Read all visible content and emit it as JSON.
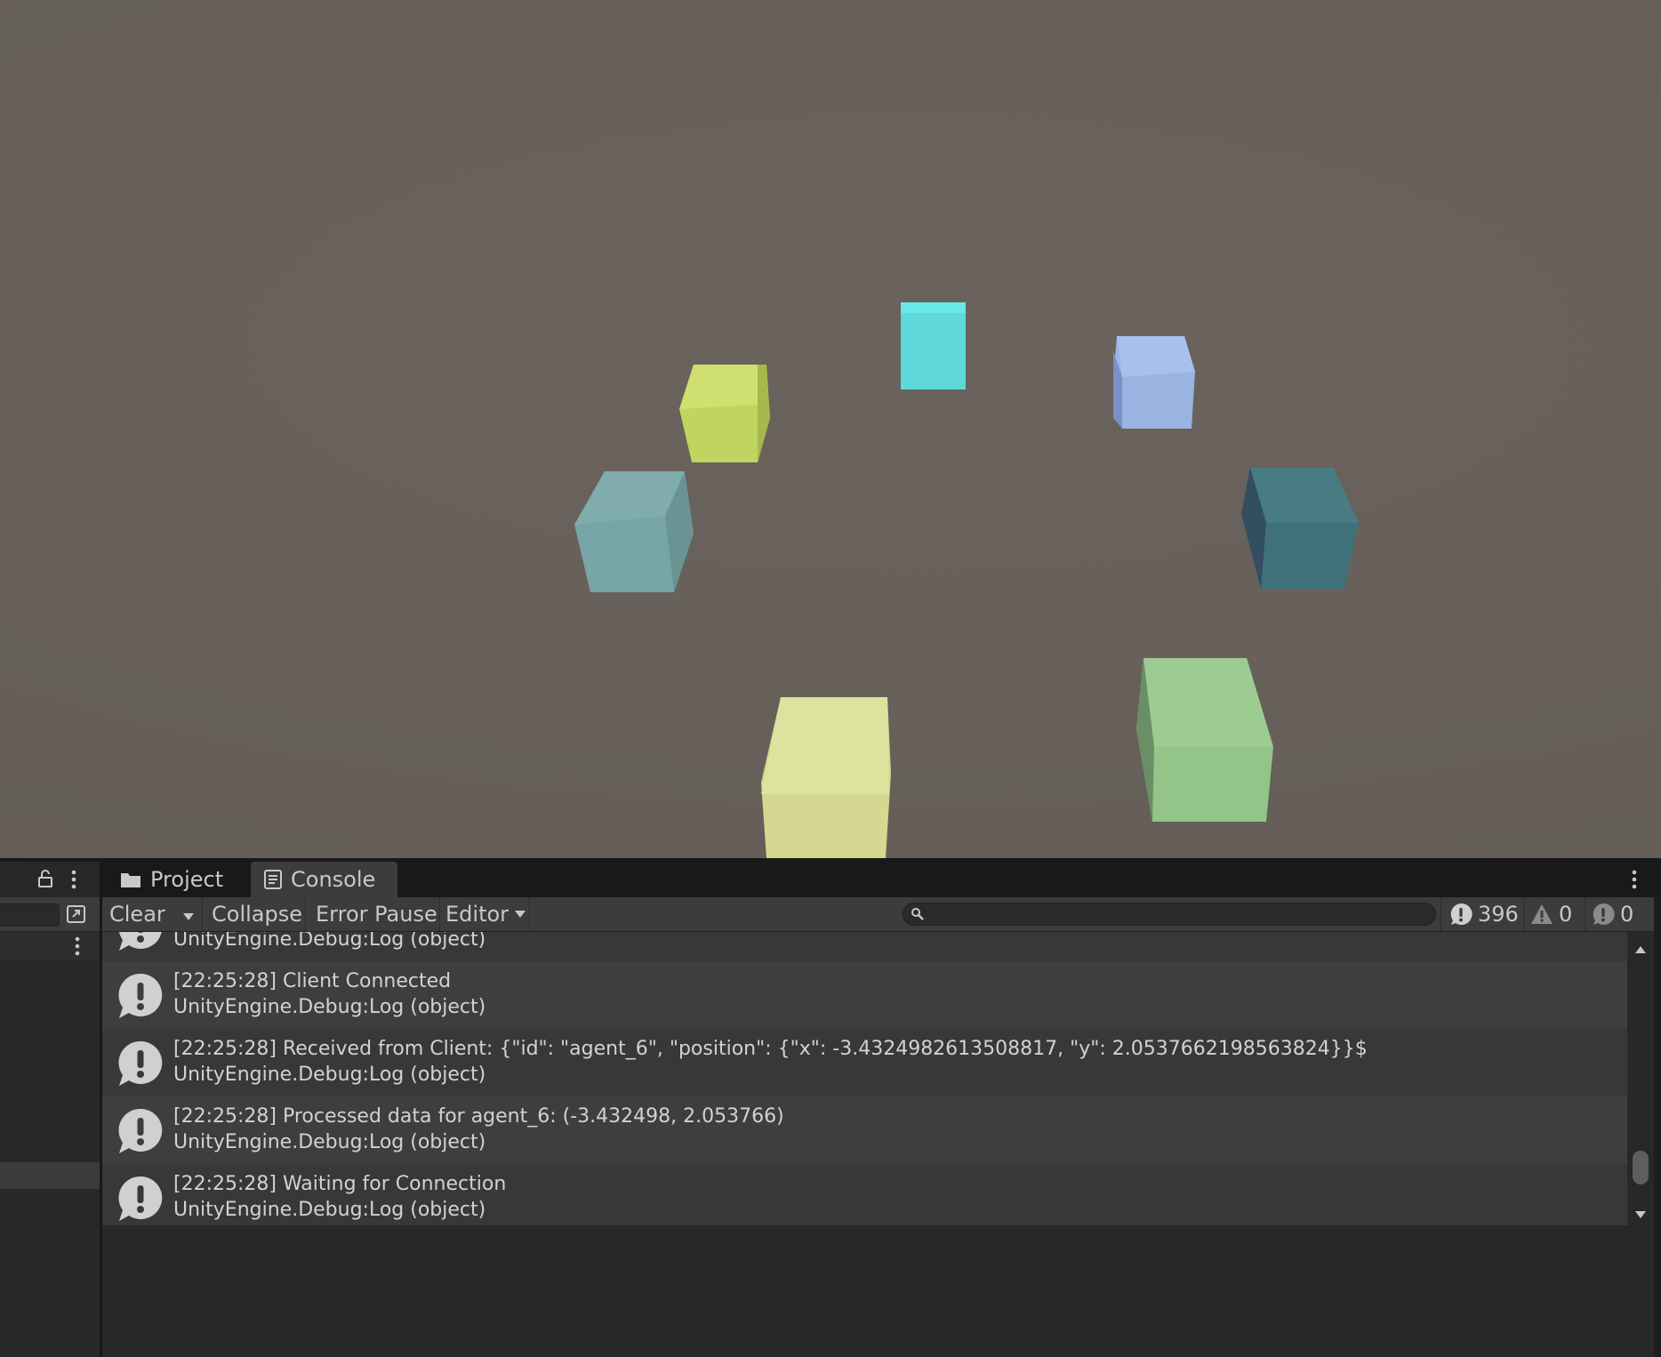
{
  "scene": {
    "cube_colors": [
      "#5ee6e6",
      "#c8dc6e",
      "#9fb8e8",
      "#7aa8aa",
      "#3f7178",
      "#dde09e",
      "#93c488"
    ]
  },
  "console": {
    "tabs": [
      {
        "label": "Project",
        "icon": "folder-icon"
      },
      {
        "label": "Console",
        "icon": "console-icon"
      }
    ],
    "toolbar": {
      "clear_label": "Clear",
      "collapse_label": "Collapse",
      "error_pause_label": "Error Pause",
      "editor_label": "Editor",
      "search_value": ""
    },
    "counts": {
      "info": "396",
      "warnings": "0",
      "errors": "0"
    },
    "logs": [
      {
        "message": "",
        "stack": "UnityEngine.Debug:Log (object)"
      },
      {
        "message": "[22:25:28] Client Connected",
        "stack": "UnityEngine.Debug:Log (object)"
      },
      {
        "message": "[22:25:28] Received from Client: {\"id\": \"agent_6\", \"position\": {\"x\": -3.4324982613508817, \"y\": 2.0537662198563824}}$",
        "stack": "UnityEngine.Debug:Log (object)"
      },
      {
        "message": "[22:25:28] Processed data for agent_6: (-3.432498, 2.053766)",
        "stack": "UnityEngine.Debug:Log (object)"
      },
      {
        "message": "[22:25:28] Waiting for Connection",
        "stack": "UnityEngine.Debug:Log (object)"
      }
    ]
  }
}
